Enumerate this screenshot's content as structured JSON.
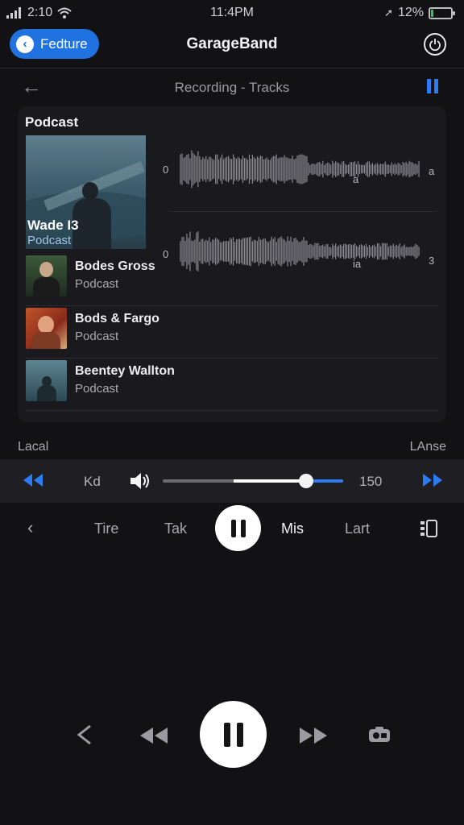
{
  "status_bar": {
    "time_left": "2:10",
    "time_center": "11:4PM",
    "battery": "12%",
    "battery_level": 0.12
  },
  "nav": {
    "back_label": "Fedture",
    "title": "GarageBand"
  },
  "subheader": {
    "title": "Recording - Tracks"
  },
  "card": {
    "title": "Podcast",
    "featured": {
      "name": "Wade I3",
      "subtitle": "Podcast"
    },
    "waveforms": [
      {
        "left_label": "0",
        "right_label": "a",
        "marker": "a"
      },
      {
        "left_label": "0",
        "right_label": "3",
        "marker": "ia"
      }
    ],
    "tracks": [
      {
        "name": "Bodes Gross",
        "subtitle": "Podcast"
      },
      {
        "name": "Bods & Fargo",
        "subtitle": "Podcast"
      },
      {
        "name": "Beentey Wallton",
        "subtitle": "Podcast"
      }
    ]
  },
  "section": {
    "left": "Lacal",
    "right": "LAnse"
  },
  "mixer": {
    "kd_label": "Kd",
    "volume_value": "150",
    "slider_level": 0.8
  },
  "tabs": [
    "Tire",
    "Tak",
    "Mis",
    "Lart"
  ],
  "active_tab": "Mis",
  "colors": {
    "accent": "#1f72e0",
    "background": "#121215",
    "card": "#1a1a1e"
  },
  "icons": [
    "signal-icon",
    "wifi-icon",
    "back-chevron-icon",
    "power-icon",
    "arrow-left-icon",
    "pause-icon",
    "rewind-icon",
    "speaker-icon",
    "fast-forward-icon",
    "side-panel-icon",
    "camera-icon"
  ]
}
